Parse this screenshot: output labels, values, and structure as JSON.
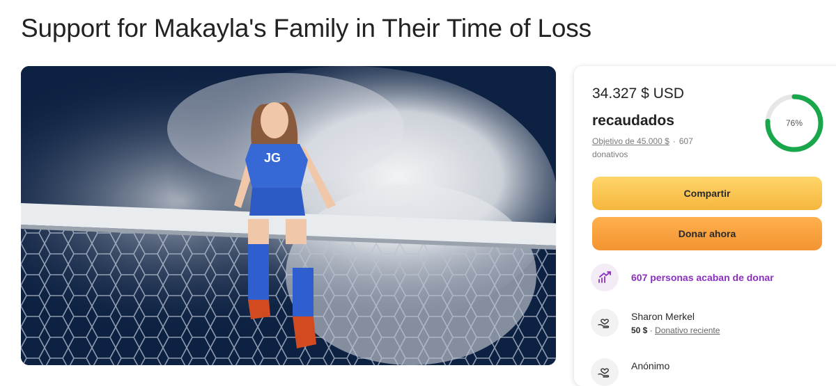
{
  "page": {
    "title": "Support for Makayla's Family in Their Time of Loss"
  },
  "hero": {
    "jersey_text": "JG"
  },
  "donation_card": {
    "amount_raised": "34.327 $ USD",
    "raised_label": "recaudados",
    "goal_text": "Objetivo de 45.000 $",
    "separator": "·",
    "donations_count": "607",
    "donations_label": "donativos",
    "progress_percent": 76,
    "progress_label": "76%",
    "share_button": "Compartir",
    "donate_button": "Donar ahora",
    "recent_activity": "607 personas acaban de donar"
  },
  "donors": [
    {
      "name": "Sharon Merkel",
      "amount": "50 $",
      "separator": "·",
      "tag": "Donativo reciente"
    },
    {
      "name": "Anónimo"
    }
  ],
  "colors": {
    "progress_ring": "#1aa64b",
    "progress_track": "#e6e6e6",
    "share_button_bg": "#f5c34d",
    "donate_button_bg": "#f5a03a",
    "recent_activity_text": "#8a2fbf"
  },
  "icons": {
    "recent_activity": "trending-up-icon",
    "donor": "hands-heart-icon"
  }
}
